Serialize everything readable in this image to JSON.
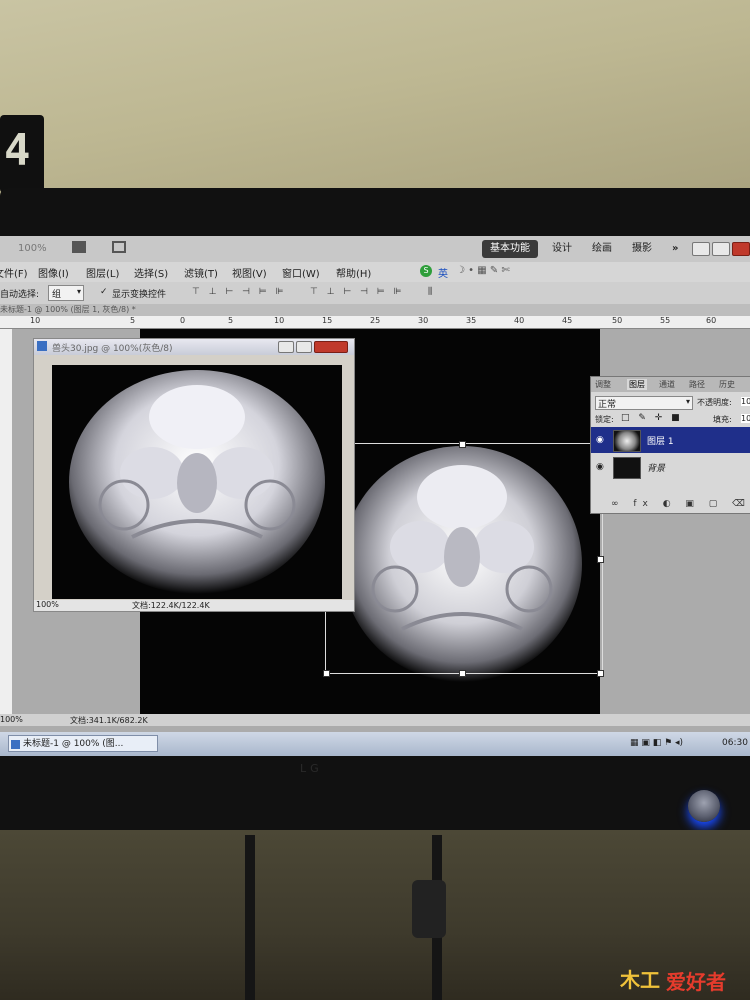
{
  "clock_digit": "4",
  "app": {
    "zoom_combo": "100%",
    "workspaces": [
      "基本功能",
      "设计",
      "绘画",
      "摄影"
    ],
    "more": "»"
  },
  "menu": [
    "文件(F)",
    "图像(I)",
    "图层(L)",
    "选择(S)",
    "滤镜(T)",
    "视图(V)",
    "窗口(W)",
    "帮助(H)"
  ],
  "ime": {
    "badge": "S",
    "lang": "英"
  },
  "options": {
    "auto_select": "自动选择:",
    "auto_select_value": "组",
    "show_transform": "显示变换控件"
  },
  "doc_tab": "未标题-1 @ 100% (图层 1, 灰色/8) *",
  "ruler": [
    "10",
    "5",
    "0",
    "5",
    "10",
    "15",
    "20",
    "25",
    "30",
    "35",
    "40",
    "45",
    "50",
    "55",
    "60"
  ],
  "float_window": {
    "title": "兽头30.jpg @ 100%(灰色/8)",
    "zoom": "100%",
    "doc_info": "文档:122.4K/122.4K"
  },
  "layers_panel": {
    "tabs": [
      "调整",
      "图层",
      "通道",
      "路径",
      "历史"
    ],
    "blend_mode": "正常",
    "opacity_label": "不透明度:",
    "opacity_value": "10",
    "lock_label": "锁定:",
    "fill_label": "填充:",
    "fill_value": "10",
    "layers": [
      {
        "name": "图层 1",
        "selected": true
      },
      {
        "name": "背景",
        "selected": false
      }
    ]
  },
  "status": {
    "zoom": "100%",
    "doc_info": "文档:341.1K/682.2K"
  },
  "taskbar": {
    "item": "未标题-1 @ 100% (图...",
    "time": "06:30"
  },
  "bezel_label": "LG",
  "watermark": {
    "brand": "木工",
    "text": "爱好者"
  },
  "colors": {
    "accent": "#1f2f8a",
    "close": "#c0392b",
    "led": "#1a4cff"
  }
}
